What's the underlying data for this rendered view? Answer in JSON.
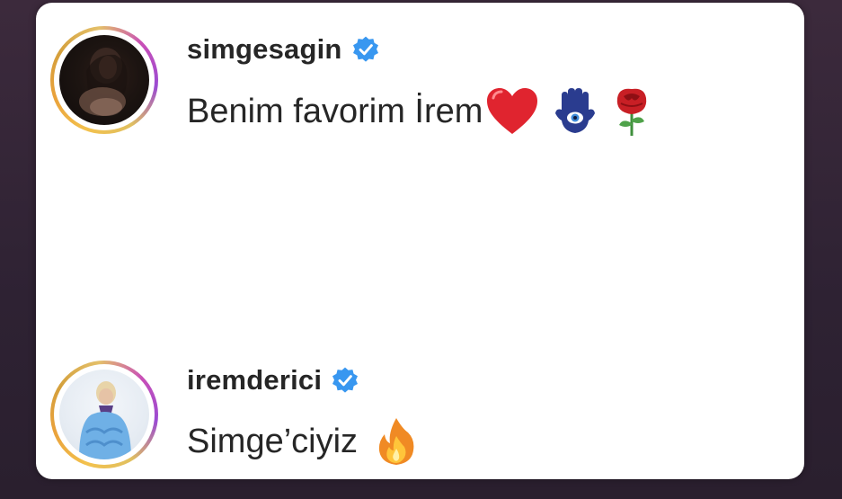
{
  "comments": [
    {
      "username": "simgesagin",
      "verified": true,
      "text": "Benim favorim İrem",
      "emojis": [
        "red-heart",
        "hamsa",
        "rose"
      ]
    },
    {
      "username": "iremderici",
      "verified": true,
      "text": "Simge’ciyiz",
      "emojis": [
        "fire"
      ]
    }
  ],
  "colors": {
    "verified_blue": "#3897f0",
    "text": "#262626",
    "heart": "#e0242f",
    "hamsa": "#2a3c8f",
    "rose": "#c81f25",
    "fire": "#f08a24"
  }
}
